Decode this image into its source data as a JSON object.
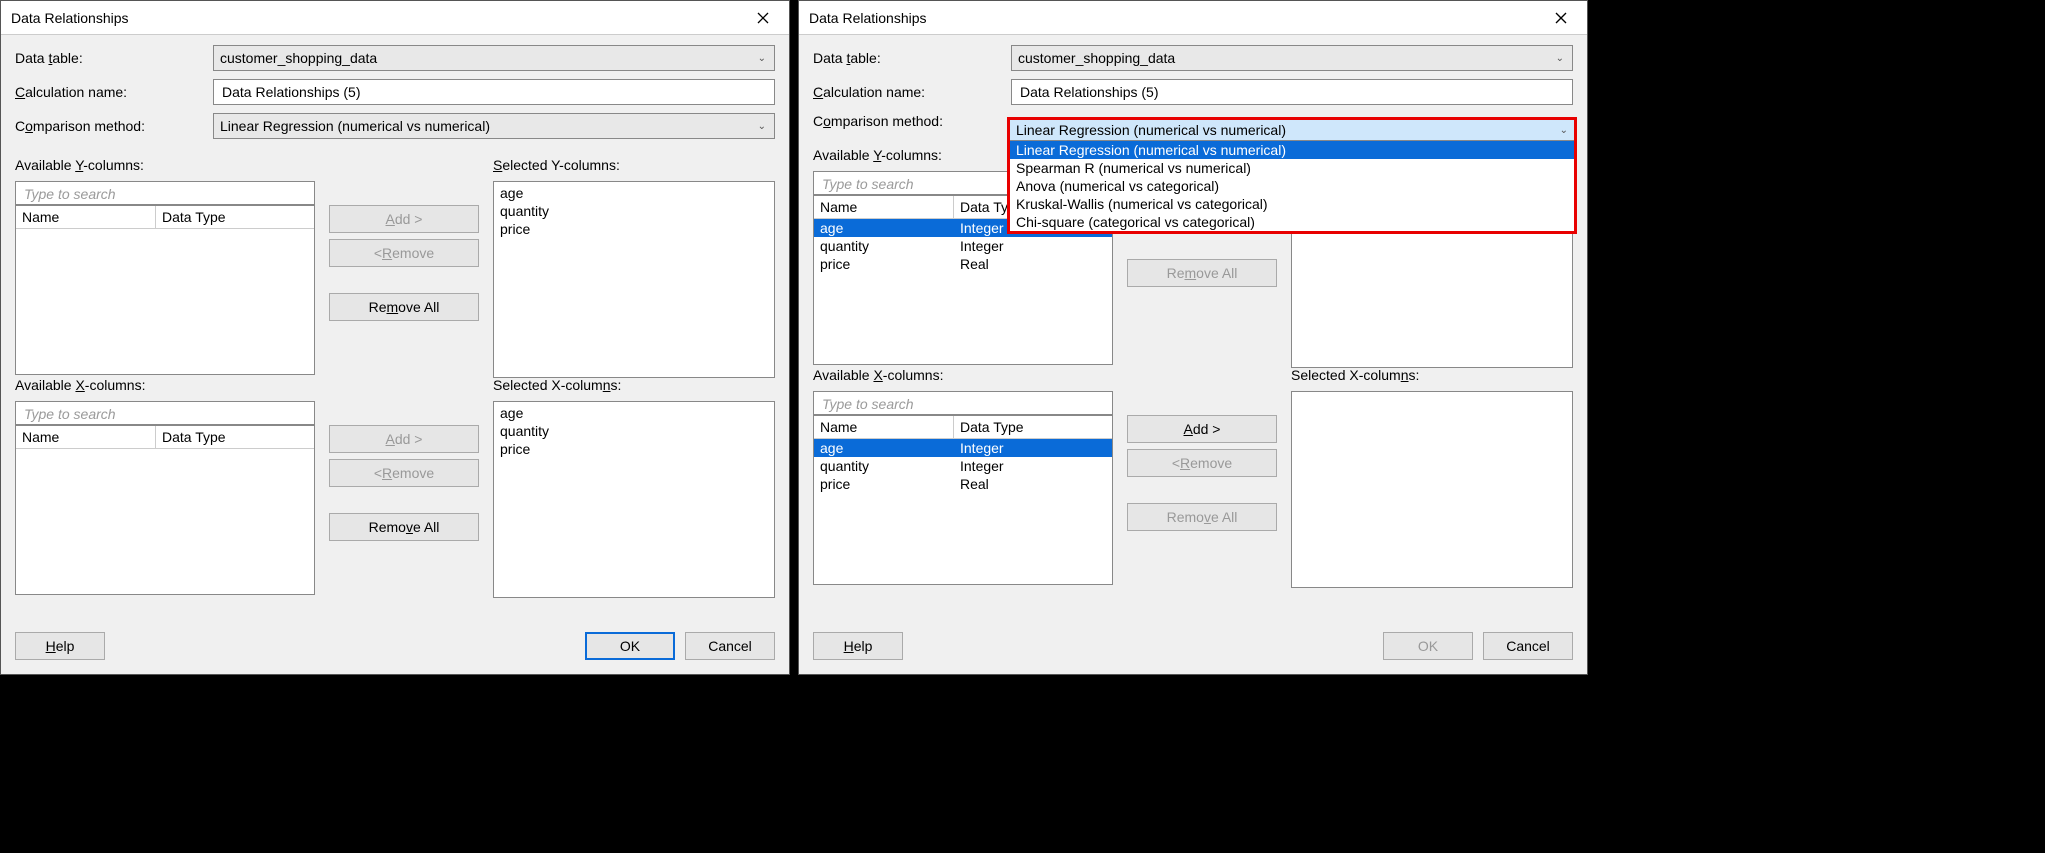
{
  "dialog_title": "Data Relationships",
  "labels": {
    "data_table": "Data table:",
    "data_table_u": "t",
    "calc_name": "Calculation name:",
    "calc_name_u": "C",
    "comp_method": "Comparison method:",
    "comp_method_u": "o",
    "avail_y": "Available Y-columns:",
    "avail_y_u": "Y",
    "sel_y": "Selected Y-columns:",
    "sel_y_u": "S",
    "avail_x": "Available X-columns:",
    "avail_x_u": "X",
    "sel_x": "Selected X-columns:",
    "sel_x_u": "n",
    "th_name": "Name",
    "th_type": "Data Type",
    "search_ph": "Type to search"
  },
  "fields": {
    "data_table": "customer_shopping_data",
    "calc_name": "Data Relationships (5)",
    "comp_method": "Linear Regression (numerical vs numerical)"
  },
  "buttons": {
    "add": "Add >",
    "add_u": "A",
    "remove": "< Remove",
    "remove_u": "R",
    "remove_all_y": "Remove All",
    "remove_all_y_u": "m",
    "remove_all_x": "Remove All",
    "remove_all_x_u": "v",
    "help": "Help",
    "help_u": "H",
    "ok": "OK",
    "cancel": "Cancel"
  },
  "left": {
    "avail_y": [],
    "avail_x": [],
    "sel_y": [
      "age",
      "quantity",
      "price"
    ],
    "sel_x": [
      "age",
      "quantity",
      "price"
    ]
  },
  "right": {
    "avail_y": [
      {
        "name": "age",
        "type": "Integer",
        "selected": true
      },
      {
        "name": "quantity",
        "type": "Integer",
        "selected": false
      },
      {
        "name": "price",
        "type": "Real",
        "selected": false
      }
    ],
    "avail_x": [
      {
        "name": "age",
        "type": "Integer",
        "selected": true
      },
      {
        "name": "quantity",
        "type": "Integer",
        "selected": false
      },
      {
        "name": "price",
        "type": "Real",
        "selected": false
      }
    ],
    "sel_y": [],
    "sel_x": []
  },
  "dropdown_options": [
    {
      "text": "Linear Regression (numerical vs numerical)",
      "selected": true
    },
    {
      "text": "Spearman R (numerical vs numerical)",
      "selected": false
    },
    {
      "text": "Anova (numerical vs categorical)",
      "selected": false
    },
    {
      "text": "Kruskal-Wallis (numerical vs categorical)",
      "selected": false
    },
    {
      "text": "Chi-square (categorical vs categorical)",
      "selected": false
    }
  ]
}
